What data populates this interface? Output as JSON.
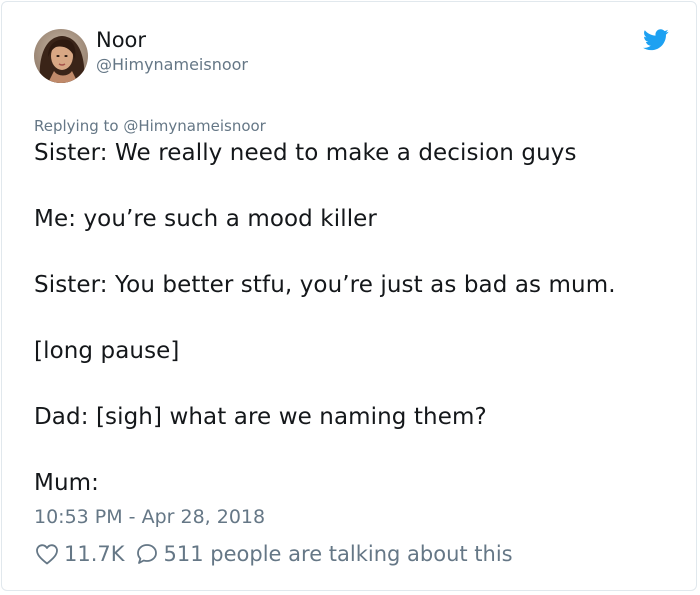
{
  "author": {
    "display_name": "Noor",
    "handle": "@Himynameisnoor"
  },
  "reply": {
    "prefix": "Replying to",
    "mention": "@Himynameisnoor"
  },
  "tweet_lines": [
    "Sister: We really need to make a decision guys",
    "Me: you’re such a mood killer",
    "Sister: You better stfu, you’re just as bad as mum.",
    "[long pause]",
    "Dad: [sigh] what are we naming them?",
    "Mum:"
  ],
  "timestamp": "10:53 PM - Apr 28, 2018",
  "engagement": {
    "likes": "11.7K",
    "conversation": "511 people are talking about this"
  },
  "colors": {
    "brand_blue": "#1da1f2",
    "text_primary": "#14171a",
    "text_secondary": "#657786",
    "border": "#e1e8ed"
  },
  "icons": {
    "brand": "twitter-bird-icon",
    "like": "heart-icon",
    "reply": "speech-bubble-icon"
  }
}
